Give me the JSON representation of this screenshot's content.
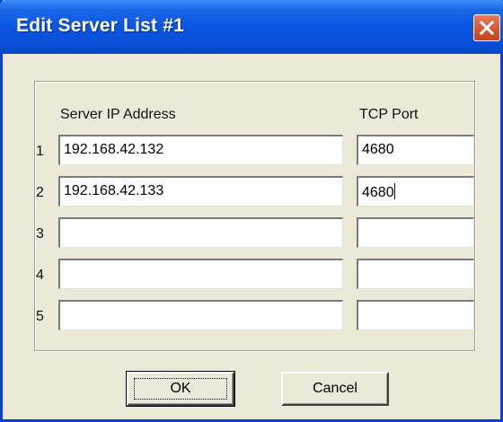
{
  "dialog": {
    "title": "Edit Server List #1"
  },
  "headers": {
    "ip": "Server IP Address",
    "port": "TCP Port"
  },
  "rows": [
    {
      "num": "1",
      "ip": "192.168.42.132",
      "port": "4680"
    },
    {
      "num": "2",
      "ip": "192.168.42.133",
      "port": "4680"
    },
    {
      "num": "3",
      "ip": "",
      "port": ""
    },
    {
      "num": "4",
      "ip": "",
      "port": ""
    },
    {
      "num": "5",
      "ip": "",
      "port": ""
    }
  ],
  "buttons": {
    "ok": "OK",
    "cancel": "Cancel"
  },
  "icons": {
    "close": "close-icon"
  },
  "colors": {
    "titlebar": "#0a55e0",
    "close_button": "#d45430",
    "dialog_background": "#ece9d8"
  }
}
